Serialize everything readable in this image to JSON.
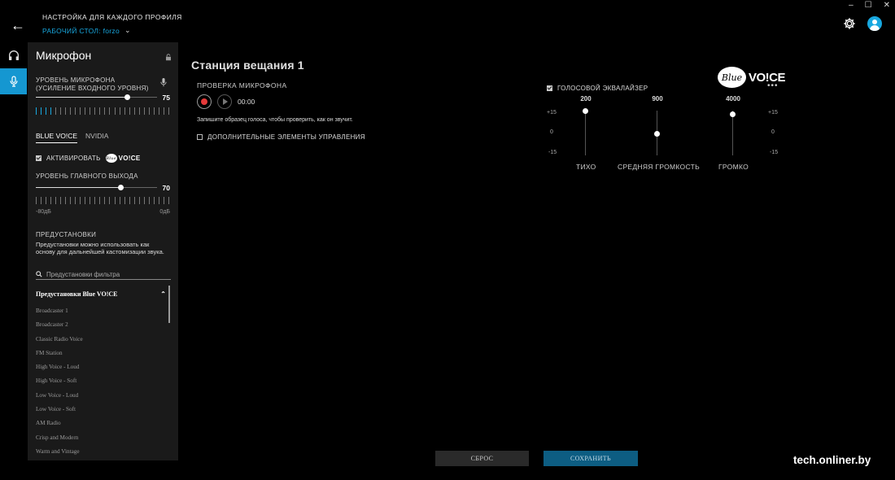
{
  "header": {
    "back_label": "←",
    "profile_title": "НАСТРОЙКА ДЛЯ КАЖДОГО ПРОФИЛЯ",
    "profile_value": "РАБОЧИЙ СТОЛ: forzo",
    "window_controls": [
      "–",
      "☐",
      "✕"
    ]
  },
  "rail": {
    "items": [
      "headphones-icon",
      "microphone-icon"
    ],
    "active": 1
  },
  "sidebar": {
    "title": "Микрофон",
    "mic_level_label": "УРОВЕНЬ МИКРОФОНА (УСИЛЕНИЕ ВХОДНОГО УРОВНЯ)",
    "mic_level_value": "75",
    "mic_level": 75,
    "tabs": [
      "BLUE VO!CE",
      "NVIDIA"
    ],
    "activate_label": "АКТИВИРОВАТЬ",
    "activate_checked": true,
    "output_label": "УРОВЕНЬ ГЛАВНОГО ВЫХОДА",
    "output_value": "70",
    "output_level": 70,
    "db_min": "-80дБ",
    "db_max": "0дБ",
    "presets_heading": "ПРЕДУСТАНОВКИ",
    "presets_desc": "Предустановки можно использовать как основу для дальнейшей кастомизации звука.",
    "filter_placeholder": "Предустановки фильтра",
    "preset_group": "Предустановки Blue VO!CE",
    "presets": [
      "Broadcaster 1",
      "Broadcaster 2",
      "Classic Radio Voice",
      "FM Station",
      "High Voice - Loud",
      "High Voice - Soft",
      "Low Voice - Loud",
      "Low Voice - Soft",
      "AM Radio",
      "Crisp and Modern",
      "Warm and Vintage"
    ]
  },
  "logo": {
    "disc_text": "Blue",
    "voice_text": "VO!CE"
  },
  "main": {
    "title": "Станция вещания 1",
    "mic_check_label": "ПРОВЕРКА МИКРОФОНА",
    "timer": "00:00",
    "hint": "Запишите образец голоса, чтобы проверить, как он звучит.",
    "advanced_label": "ДОПОЛНИТЕЛЬНЫЕ ЭЛЕМЕНТЫ УПРАВЛЕНИЯ"
  },
  "eq": {
    "label": "ГОЛОСОВОЙ ЭКВАЛАЙЗЕР",
    "more": "•••",
    "scale": [
      "+15",
      "0",
      "-15"
    ],
    "bands": [
      {
        "freq": "200",
        "value": 15
      },
      {
        "freq": "900",
        "value": 0
      },
      {
        "freq": "4000",
        "value": 13
      }
    ],
    "zones": [
      "ТИХО",
      "СРЕДНЯЯ ГРОМКОСТЬ",
      "ГРОМКО"
    ]
  },
  "buttons": {
    "reset": "СБРОС",
    "save": "СОХРАНИТЬ"
  },
  "watermark": "tech.onliner.by",
  "colors": {
    "accent": "#18a8e0",
    "save_bg": "#0d5d82",
    "record": "#e63a3a"
  }
}
